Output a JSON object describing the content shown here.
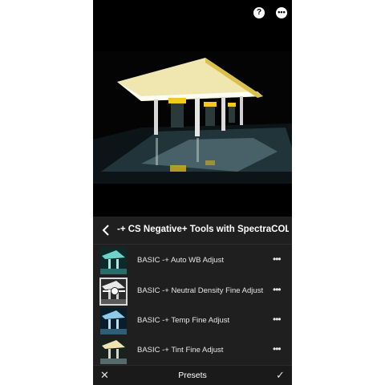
{
  "topbar": {
    "help_icon": "help-circle-icon",
    "more_icon": "more-horizontal-icon",
    "help_glyph": "?",
    "more_glyph": "•••"
  },
  "panel": {
    "back_icon": "chevron-left-icon",
    "title": "-+ CS Negative+ Tools with SpectraCOLOR™ (P...",
    "presets": [
      {
        "label": "BASIC -+ Auto WB Adjust",
        "selected": false
      },
      {
        "label": "BASIC -+ Neutral Density Fine Adjust",
        "selected": true
      },
      {
        "label": "BASIC -+ Temp Fine Adjust",
        "selected": false
      },
      {
        "label": "BASIC -+ Tint Fine Adjust",
        "selected": false
      }
    ],
    "more_glyph": "•••"
  },
  "footer": {
    "cancel_glyph": "✕",
    "title": "Presets",
    "confirm_glyph": "✓"
  },
  "colors": {
    "panel_bg": "#1f1f1f",
    "canopy": "#f2d86a",
    "sign": "#f4c81e",
    "text": "#e6e6e6"
  }
}
